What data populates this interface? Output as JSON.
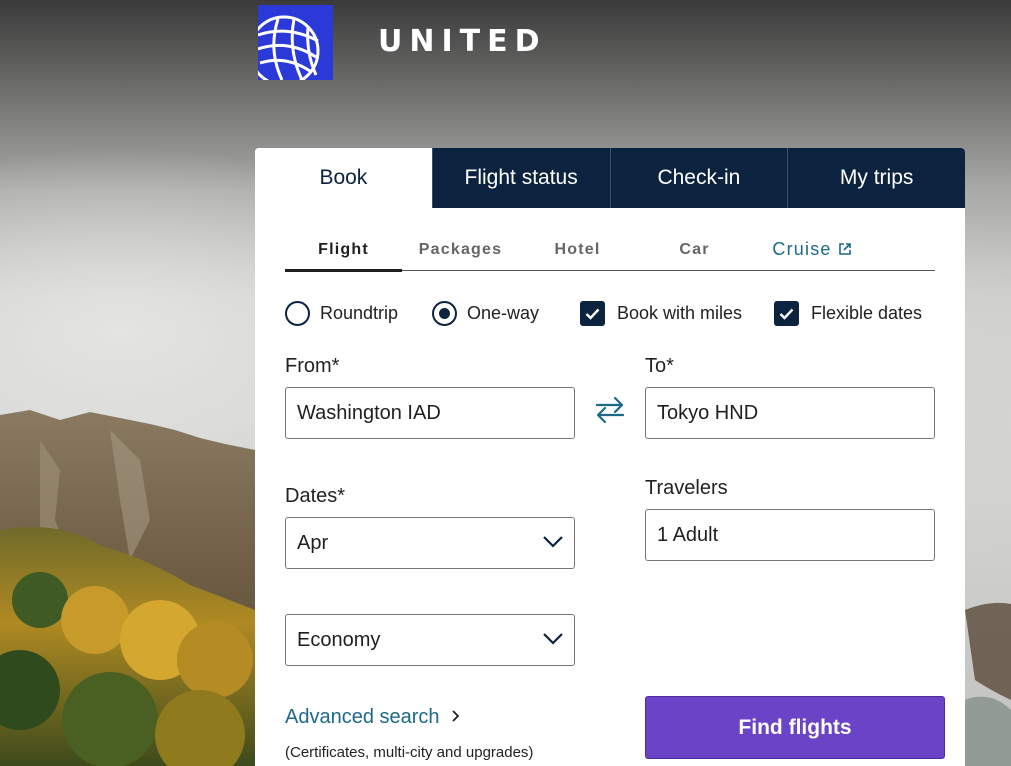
{
  "brand": {
    "name": "UNITED",
    "logo_icon": "united-globe-icon"
  },
  "tabs": [
    {
      "label": "Book",
      "active": true
    },
    {
      "label": "Flight status",
      "active": false
    },
    {
      "label": "Check-in",
      "active": false
    },
    {
      "label": "My trips",
      "active": false
    }
  ],
  "subtabs": [
    {
      "label": "Flight",
      "active": true
    },
    {
      "label": "Packages",
      "active": false
    },
    {
      "label": "Hotel",
      "active": false
    },
    {
      "label": "Car",
      "active": false
    },
    {
      "label": "Cruise",
      "active": false,
      "external": true,
      "icon": "external-link-icon"
    }
  ],
  "trip_options": {
    "roundtrip": {
      "label": "Roundtrip",
      "selected": false
    },
    "oneway": {
      "label": "One-way",
      "selected": true
    },
    "book_with_miles": {
      "label": "Book with miles",
      "checked": true
    },
    "flexible_dates": {
      "label": "Flexible dates",
      "checked": true
    }
  },
  "form": {
    "from": {
      "label": "From*",
      "value": "Washington IAD"
    },
    "to": {
      "label": "To*",
      "value": "Tokyo HND"
    },
    "dates": {
      "label": "Dates*",
      "value": "Apr"
    },
    "travelers": {
      "label": "Travelers",
      "value": "1 Adult"
    },
    "cabin": {
      "value": "Economy"
    }
  },
  "advanced_search": {
    "label": "Advanced search",
    "note": "(Certificates, multi-city and upgrades)"
  },
  "find_button": {
    "label": "Find flights"
  },
  "colors": {
    "navy": "#0c2340",
    "accent_purple": "#6a43c6",
    "link_teal": "#1b6a8a",
    "logo_blue": "#2a39d8"
  }
}
